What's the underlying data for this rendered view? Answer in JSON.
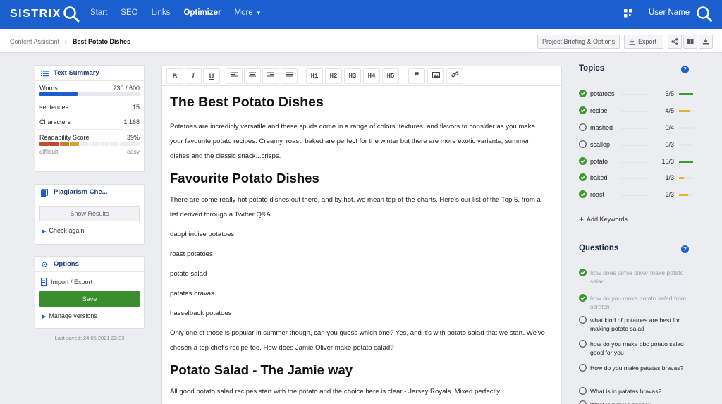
{
  "brand": "SISTRIX",
  "nav": {
    "items": [
      "Start",
      "SEO",
      "Links",
      "Optimizer",
      "More"
    ],
    "active": "Optimizer"
  },
  "user": {
    "name": "User Name"
  },
  "breadcrumb": {
    "parent": "Content Assistant",
    "current": "Best Potato Dishes"
  },
  "actions": {
    "project_briefing": "Project Briefing & Options",
    "export": "Export"
  },
  "text_summary": {
    "title": "Text Summary",
    "words_label": "Words",
    "words_value": "230 / 600",
    "words_progress": 0.383,
    "sentences_label": "sentences",
    "sentences_value": "15",
    "characters_label": "Characters",
    "characters_value": "1.168",
    "readability_label": "Readability Score",
    "readability_value": "39%",
    "readability_level": 0.39,
    "scale_left": "difficult",
    "scale_right": "easy"
  },
  "plagiarism": {
    "title": "Plagiarism Che...",
    "show_results": "Show Results",
    "check_again": "Check again"
  },
  "options": {
    "title": "Options",
    "import_export": "Import / Export",
    "save": "Save",
    "manage_versions": "Manage versions"
  },
  "last_saved": "Last saved: 24.05.2021 22:33",
  "toolbar": [
    "B",
    "I",
    "U",
    "align-left",
    "align-center",
    "align-right",
    "align-justify",
    "H1",
    "H2",
    "H3",
    "H4",
    "H5",
    "quote",
    "image",
    "link"
  ],
  "document": {
    "h1": "The Best Potato Dishes",
    "p1": "Potatoes are incredibly versatile and these spuds come in a range of colors, textures, and flavors to consider as you make your favourite potato recipes. Creamy, roast, baked are perfect for the winter but there are more exotic variants, summer dishes and the classic snack...crisps.",
    "h2a": "Favourite Potato Dishes",
    "p2": "There are some really hot potato dishes out there, and by hot, we mean top-of-the-charts. Here's our list of the Top 5, from a list derived through a Twitter Q&A.",
    "list": [
      "dauphinoise potatoes",
      "roast potatoes",
      "potato salad",
      "patatas bravas",
      "hasselback potatoes"
    ],
    "p3": "Only one of those is popular in summer though, can you guess which one? Yes, and it's with potato salad that we start. We've chosen a top chef's recipe too. How does Jamie Oliver make potato salad?",
    "h2b": "Potato Salad - The Jamie way",
    "p4": "All good potato salad recipes start with the potato and the choice here is clear - Jersey Royals. Mixed perfectly"
  },
  "topics": {
    "title": "Topics",
    "items": [
      {
        "name": "potatoes",
        "count": "5/5",
        "done": true,
        "level": 1.0,
        "color": "#3c9a2f"
      },
      {
        "name": "recipe",
        "count": "4/5",
        "done": true,
        "level": 0.8,
        "color": "#e0b42a"
      },
      {
        "name": "mashed",
        "count": "0/4",
        "done": false,
        "level": 0,
        "color": "#3c9a2f"
      },
      {
        "name": "scallop",
        "count": "0/3",
        "done": false,
        "level": 0,
        "color": "#3c9a2f"
      },
      {
        "name": "potato",
        "count": "15/3",
        "done": true,
        "level": 1.0,
        "color": "#3c9a2f"
      },
      {
        "name": "baked",
        "count": "1/3",
        "done": true,
        "level": 0.33,
        "color": "#e0b42a"
      },
      {
        "name": "roast",
        "count": "2/3",
        "done": true,
        "level": 0.66,
        "color": "#e0b42a"
      }
    ],
    "add_keywords": "Add Keywords"
  },
  "questions": {
    "title": "Questions",
    "items": [
      {
        "text": "how does jamie oliver make potato salad",
        "done": true
      },
      {
        "text": "how do you make potato salad from scratch",
        "done": true
      },
      {
        "text": "what kind of potatoes are best for making potato salad",
        "done": false
      },
      {
        "text": "how do you make bbc potato salad good for you",
        "done": false
      },
      {
        "text": "How do you make patatas bravas?",
        "done": false
      },
      {
        "text": "What is in patatas bravas?",
        "done": false
      },
      {
        "text": "What is bravas sauce?",
        "done": false
      }
    ]
  },
  "colors": {
    "brand": "#1b5fcf",
    "save": "#3c8d2f",
    "check": "#3c9a2f",
    "warn": "#e0b42a"
  }
}
